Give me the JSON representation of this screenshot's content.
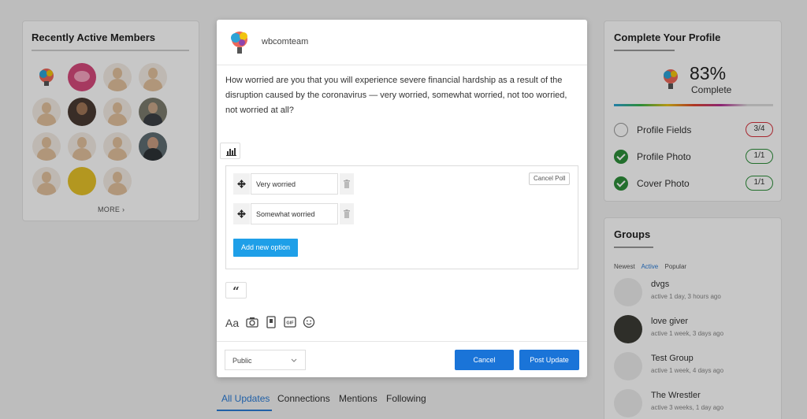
{
  "members": {
    "title": "Recently Active Members",
    "more_label": "MORE ›"
  },
  "profile": {
    "title": "Complete Your Profile",
    "percent": "83%",
    "percent_label": "Complete",
    "fields": [
      {
        "label": "Profile Fields",
        "count": "3/4",
        "complete": false
      },
      {
        "label": "Profile Photo",
        "count": "1/1",
        "complete": true
      },
      {
        "label": "Cover Photo",
        "count": "1/1",
        "complete": true
      }
    ]
  },
  "groups": {
    "title": "Groups",
    "tabs": [
      "Newest",
      "Active",
      "Popular"
    ],
    "active_tab": "Active",
    "items": [
      {
        "name": "dvgs",
        "meta": "active 1 day, 3 hours ago"
      },
      {
        "name": "love giver",
        "meta": "active 1 week, 3 days ago"
      },
      {
        "name": "Test Group",
        "meta": "active 1 week, 4 days ago"
      },
      {
        "name": "The Wrestler",
        "meta": "active 3 weeks, 1 day ago"
      }
    ]
  },
  "feed_tabs": [
    "All Updates",
    "Connections",
    "Mentions",
    "Following"
  ],
  "modal": {
    "username": "wbcomteam",
    "post_text": "How worried are you that you will experience severe financial hardship as a result of the disruption caused by the coronavirus — very worried, somewhat worried, not too worried, not worried at all?",
    "cancel_poll": "Cancel Poll",
    "options": [
      "Very worried",
      "Somewhat worried"
    ],
    "add_option": "Add new option",
    "quote_glyph": "“",
    "format_label": "Aa",
    "privacy": "Public",
    "cancel": "Cancel",
    "post": "Post Update"
  },
  "colors": {
    "primary": "#1a74d8",
    "add_option": "#1e9fe8",
    "complete_green": "#2d8f3a",
    "incomplete_red": "#d6313b"
  }
}
